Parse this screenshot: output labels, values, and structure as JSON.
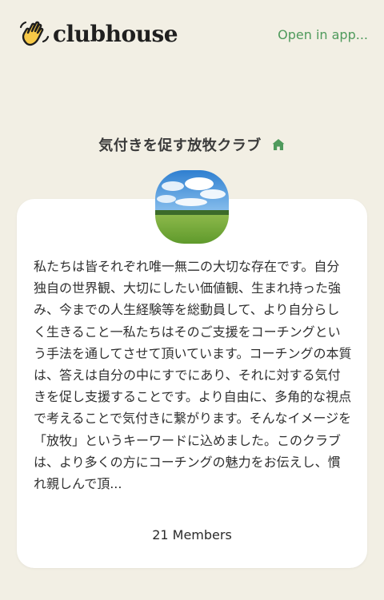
{
  "header": {
    "logo_text": "clubhouse",
    "open_link": "Open in app..."
  },
  "club": {
    "name": "気付きを促す放牧クラブ",
    "description": "私たちは皆それぞれ唯一無二の大切な存在です。自分独自の世界観、大切にしたい価値観、生まれ持った強み、今までの人生経験等を総動員して、より自分らしく生きること一私たちはそのご支援をコーチングという手法を通してさせて頂いています。コーチングの本質は、答えは自分の中にすでにあり、それに対する気付きを促し支援することです。より自由に、多角的な視点で考えることで気付きに繋がります。そんなイメージを「放牧」というキーワードに込めました。このクラブは、より多くの方にコーチングの魅力をお伝えし、慣れ親しんで頂...",
    "members": "21 Members"
  },
  "colors": {
    "background": "#f2efe4",
    "accent": "#4f9a5c",
    "card": "#ffffff"
  },
  "icons": [
    "waving-hand-icon",
    "home-icon"
  ]
}
